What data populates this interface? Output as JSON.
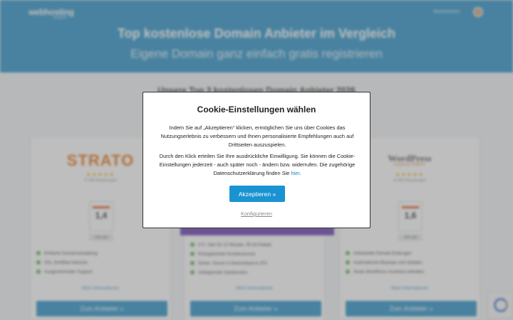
{
  "header": {
    "logo": "webhosting",
    "logo_sub": "vergleich",
    "nav_label": "Werbehinweis",
    "title": "Top kostenlose Domain Anbieter im Vergleich",
    "subtitle": "Eigene Domain ganz einfach gratis registrieren"
  },
  "section": {
    "heading": "Unsere Top 3 kostenlosen Domain Anbieter 2026"
  },
  "cards": [
    {
      "brand": "STRATO",
      "stars": "★★★★★",
      "reviews": "47.096 Bewertungen",
      "score": "1,4",
      "grade": "sehr gut",
      "features": [
        "Einfache Domainverwaltung",
        "SSL-Zertifikat inklusive",
        "Ausgezeichneter Support"
      ],
      "more_info": "Mehr Informationen",
      "cta": "Zum Anbieter »"
    },
    {
      "features": [
        "0 € / Jahr für 12 Monate, 0€ mit Rabatt",
        "Preisgekrönter Kundenservice",
        "Sicher: Server in Deutschland & 2FA",
        "Unbegrenzte Subdomains"
      ],
      "more_info": "Mehr Informationen",
      "cta": "Zum Anbieter »"
    },
    {
      "brand": "WordPress",
      "byline": "Hosted by STRATO",
      "stars": "★★★★★",
      "reviews": "31.965 Bewertungen",
      "score": "1,6",
      "grade": "sehr gut",
      "features": [
        "Individuelle Domain-Endungen",
        "Automatische Backups und Updates",
        "Strato WordPress Assistent enthalten"
      ],
      "more_info": "Mehr Informationen",
      "cta": "Zum Anbieter »"
    }
  ],
  "cookie_modal": {
    "title": "Cookie-Einstellungen wählen",
    "paragraph1": "Indem Sie auf „Akzeptieren“ klicken, ermöglichen Sie uns über Cookies das Nutzungserlebnis zu verbessern und Ihnen personalisierte Empfehlungen auch auf Drittseiten auszuspielen.",
    "paragraph2": "Durch den Klick erteilen Sie Ihre ausdrückliche Einwilligung. Sie können die Cookie-Einstellungen jederzeit - auch später noch - ändern bzw. widerrufen. Die zugehörige Datenschutzerklärung finden Sie",
    "link_text": "hier",
    "accept_label": "Akzeptieren »",
    "configure_label": "Konfigurieren"
  },
  "colors": {
    "brand_blue": "#2a93c9",
    "button_blue": "#1a93d2",
    "strato_orange": "#e8761a",
    "feature_green": "#59b84a"
  }
}
